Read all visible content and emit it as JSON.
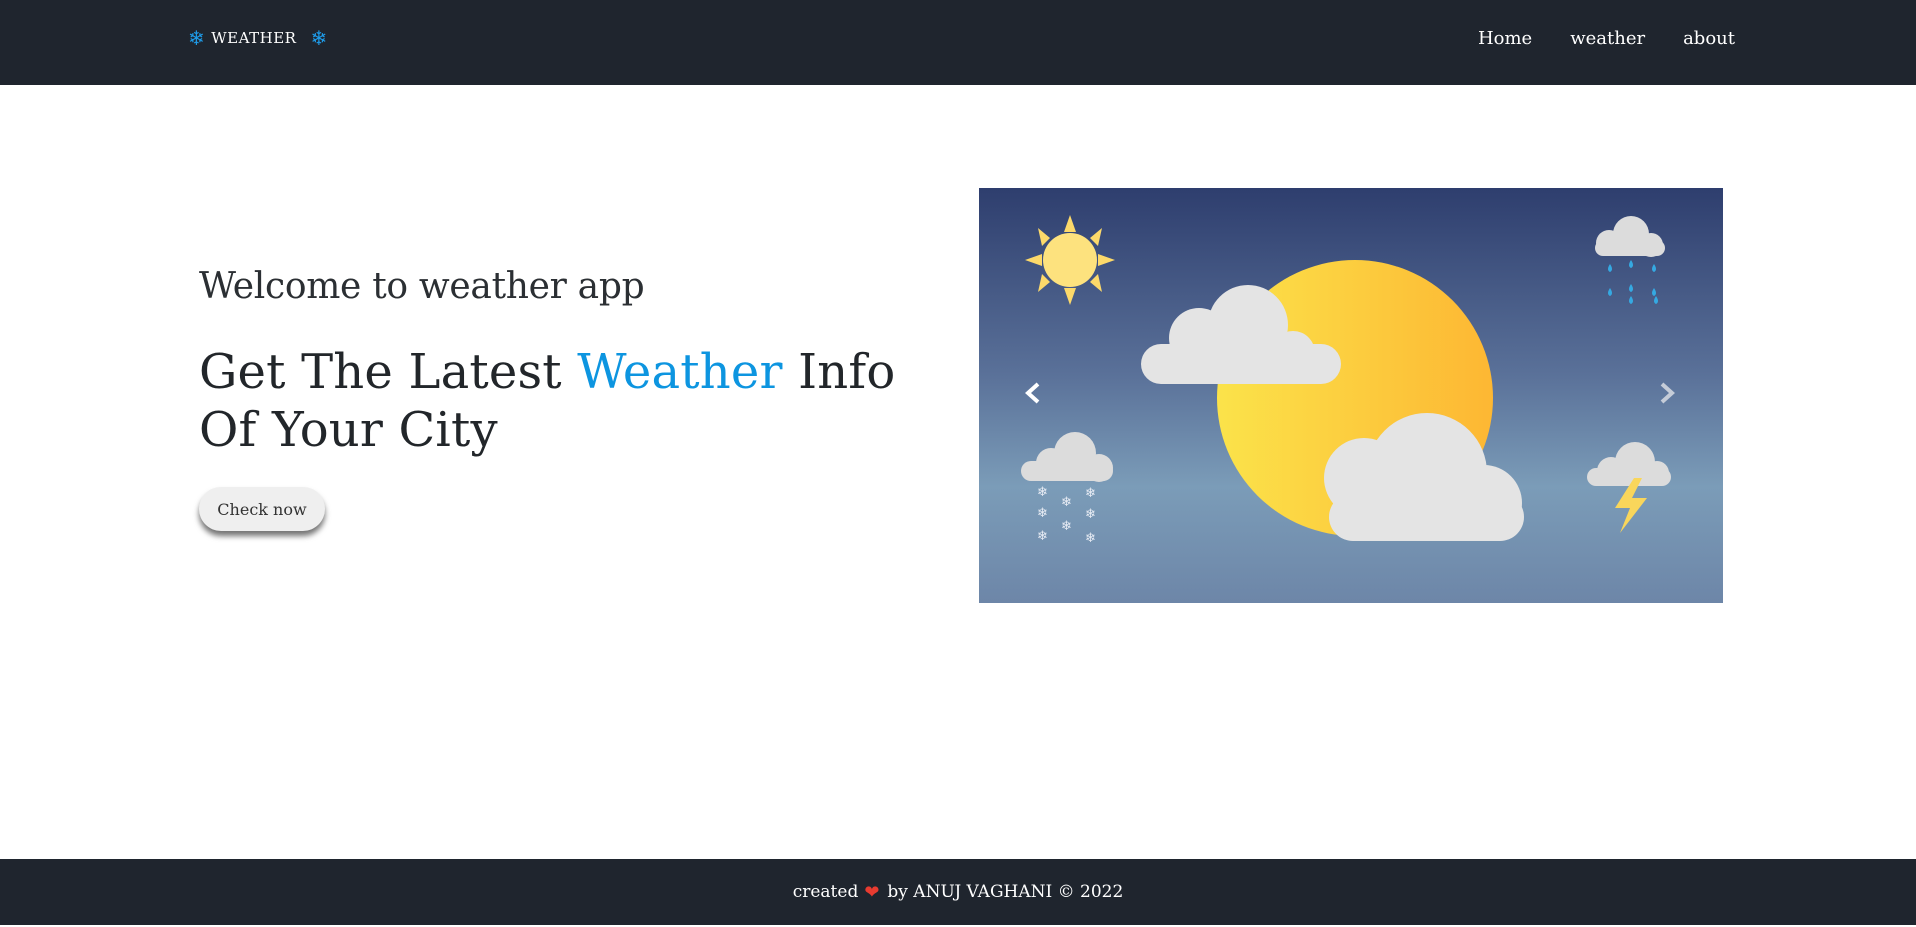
{
  "navbar": {
    "brand": "WEATHER",
    "brand_icon": "snowflake-icon",
    "links": [
      {
        "label": "Home"
      },
      {
        "label": "weather"
      },
      {
        "label": "about"
      }
    ]
  },
  "hero": {
    "welcome": "Welcome to weather app",
    "headline_pre": "Get The Latest ",
    "headline_accent": "Weather",
    "headline_post": " Info Of Your City",
    "button_label": "Check now"
  },
  "carousel": {
    "prev_icon": "chevron-left-icon",
    "next_icon": "chevron-right-icon",
    "illustration": [
      "sun-icon",
      "rain-cloud-icon",
      "snow-cloud-icon",
      "thunder-cloud-icon",
      "sun-behind-clouds"
    ]
  },
  "footer": {
    "created": "created",
    "by": "by ANUJ VAGHANI © 2022"
  },
  "colors": {
    "navbar": "#1f252e",
    "accent": "#0d95e0",
    "heart": "#e83b30"
  }
}
